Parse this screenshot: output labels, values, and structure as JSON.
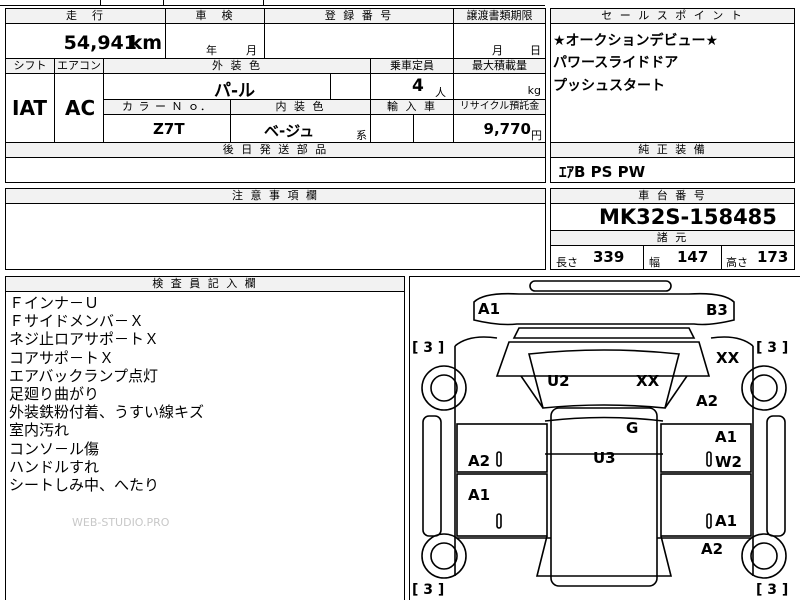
{
  "top": {
    "mileage_header": "走　行",
    "mileage_value": "54,941",
    "mileage_unit": "km",
    "inspection_header": "車　検",
    "inspection_year": "年",
    "inspection_month": "月",
    "registration_header": "登 録 番 号",
    "transfer_header": "譲渡書類期限",
    "transfer_month": "月",
    "transfer_day": "日"
  },
  "spec": {
    "shift_header": "シフト",
    "shift_value": "IAT",
    "aircon_header": "エアコン",
    "aircon_value": "AC",
    "exterior_header": "外 装 色",
    "exterior_value": "パ-ル",
    "capacity_header": "乗車定員",
    "capacity_value": "4",
    "capacity_unit": "人",
    "maxload_header": "最大積載量",
    "maxload_unit": "kg",
    "color_no_header": "カ ラ ー Ｎ ｏ．",
    "color_no_value": "Z7T",
    "interior_header": "内 装 色",
    "interior_value": "ベ-ジュ",
    "interior_suffix": "系",
    "import_header": "輸 入 車",
    "recycle_header": "リサイクル預託金",
    "recycle_value": "9,770",
    "recycle_unit": "円",
    "later_parts_header": "後 日 発 送 部 品"
  },
  "sales_points": {
    "header": "セ ー ル ス ポ イ ン ト",
    "lines": [
      "★オークションデビュー★",
      "パワースライドドア",
      "プッシュスタート"
    ]
  },
  "genuine_equipment": {
    "header": "純 正 装 備",
    "value": "ｴｱB PS PW"
  },
  "caution": {
    "header": "注 意 事 項 欄"
  },
  "chassis": {
    "header": "車 台 番 号",
    "value": "MK32S-158485",
    "spec_header": "諸 元",
    "length_label": "長さ",
    "length_value": "339",
    "width_label": "幅",
    "width_value": "147",
    "height_label": "高さ",
    "height_value": "173"
  },
  "inspector": {
    "header": "検 査 員 記 入 欄",
    "lines": [
      "Ｆインナ－Ｕ",
      "Ｆサイドメンバ－Ｘ",
      "ネジ止ロアサポ－トＸ",
      "コアサポ－トＸ",
      "エアバックランプ点灯",
      "足廻り曲がり",
      "外装鉄粉付着、うすい線キズ",
      "室内汚れ",
      "コンソ－ル傷",
      "ハンドルすれ",
      "シートしみ中、へたり"
    ],
    "watermark": "WEB-STUDIO.PRO"
  },
  "diagram": {
    "marks": {
      "front_left": "A1",
      "front_right": "B3",
      "hood_left": "U2",
      "hood_right": "XX",
      "right_front_fender_top": "XX",
      "right_front_fender": "A2",
      "roof_center": "G",
      "roof": "U3",
      "left_door_front": "A2",
      "left_door_rear": "A1",
      "right_door_front": "A1",
      "right_door_front_2": "W2",
      "right_door_rear": "A1",
      "right_rear_fender": "A2"
    },
    "tire_marks": [
      "[ 3 ]",
      "[ 3 ]",
      "[ 3 ]",
      "[ 3 ]"
    ]
  }
}
